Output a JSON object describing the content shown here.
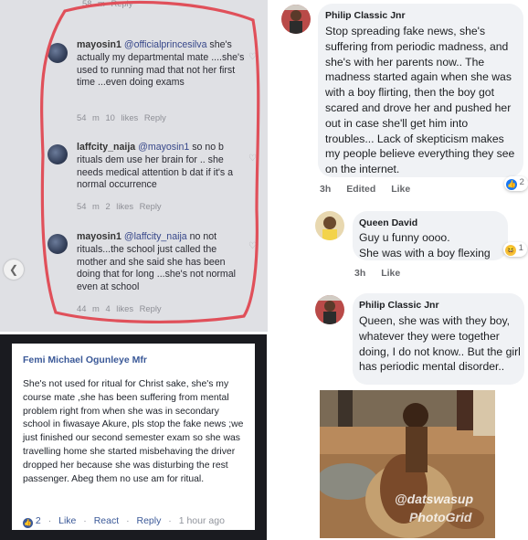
{
  "instagram": {
    "top_meta": "58 m   Reply",
    "comments": [
      {
        "user": "mayosin1",
        "mention": "@officialprincesilva",
        "text": "she's actually my departmental mate ....she's used to running mad that not her first time ...even doing exams",
        "meta": "54 m   10 likes   Reply"
      },
      {
        "user": "laffcity_naija",
        "mention": "@mayosin1",
        "text": "so no b rituals dem use her brain for .. she needs medical attention b dat if it's a normal occurrence",
        "meta": "54 m   2 likes   Reply"
      },
      {
        "user": "mayosin1",
        "mention": "@laffcity_naija",
        "text": "no not rituals...the school just called the mother and she said she has been doing that for long ...she's not normal even at school",
        "meta": "44 m   4 likes   Reply"
      }
    ],
    "circle_color": "#e0505a"
  },
  "femi": {
    "name": "Femi Michael Ogunleye Mfr",
    "body": "She's not used for ritual for Christ sake, she's my course mate ,she has been suffering from mental problem right from when she was in secondary school in fiwasaye Akure, pls stop the fake news ;we just finished our second semester exam so she was travelling home she started misbehaving the driver dropped her because she was disturbing the rest passenger. Abeg them no use am for ritual.",
    "like_count": "2",
    "like_label": "Like",
    "react_label": "React",
    "reply_label": "Reply",
    "time": "1 hour ago"
  },
  "facebook": {
    "comments": [
      {
        "name": "Philip Classic Jnr",
        "text": "Stop spreading fake news, she's suffering from periodic madness, and she's with her parents now.. The madness started again when she was with a boy flirting, then the boy got scared and drove her and pushed her out in case she'll get him into troubles... Lack of skepticism makes my people believe everything they see on the internet.",
        "time": "3h",
        "edited": "Edited",
        "like": "Like",
        "reaction_count": "2"
      },
      {
        "name": "Queen David",
        "text": "Guy u funny oooo.\nShe was with a boy flexing",
        "time": "3h",
        "like": "Like",
        "reaction_count": "1"
      },
      {
        "name": "Philip Classic Jnr",
        "text": "Queen, she was with they boy, whatever they were together doing, I do not know.. But the girl has periodic mental disorder..",
        "time": "",
        "like": ""
      }
    ],
    "watermark": {
      "line1": "@datswasup",
      "line2": "PhotoGrid"
    }
  }
}
